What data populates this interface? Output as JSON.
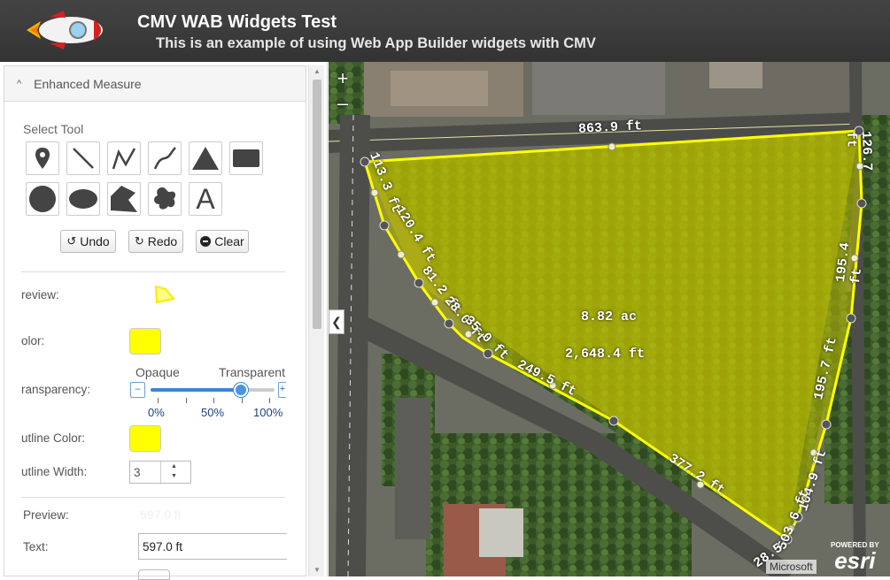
{
  "header": {
    "title": "CMV WAB Widgets Test",
    "subtitle": "This is an example of using Web App Builder widgets with CMV"
  },
  "panel": {
    "title": "Enhanced Measure",
    "select_tool": "Select Tool",
    "tools": [
      "point",
      "line",
      "polyline",
      "freehand-polyline",
      "triangle",
      "rectangle",
      "circle",
      "ellipse",
      "polygon",
      "freehand-polygon",
      "text"
    ],
    "text_tool_glyph": "A",
    "buttons": {
      "undo": "Undo",
      "redo": "Redo",
      "clear": "Clear"
    },
    "preview_label": "review:",
    "color_label": "olor:",
    "transparency_label": "ransparency:",
    "slider": {
      "left_label": "Opaque",
      "right_label": "Transparent",
      "ticks": [
        "0%",
        "50%",
        "100%"
      ],
      "value_percent": 73,
      "minus": "–",
      "plus": "+"
    },
    "outline_color_label": "utline Color:",
    "outline_width_label": "utline Width:",
    "outline_width_value": "3",
    "fill_color": "#ffff00",
    "text_section": {
      "preview_label": "Preview:",
      "preview_value": "597.0 ft",
      "text_label": "Text:",
      "text_value": "597.0 ft"
    }
  },
  "map": {
    "zoom_in": "+",
    "zoom_out": "–",
    "collapse": "❮",
    "labels": {
      "top": "863.9 ft",
      "area": "8.82 ac",
      "perimeter": "2,648.4 ft",
      "mid": "249.5 ft",
      "bottom_edge": "377.2 ft",
      "right1": "126.7 ft",
      "right2": "195.4 ft",
      "right3": "195.7 ft",
      "right4": "104.9 ft",
      "right5": "503.6 ft",
      "bottom": "28.5",
      "left1": "113.3 ft",
      "left2": "120.4 ft",
      "left3": "81.2 ft",
      "left4": "28.0 ft",
      "left5": "35.0 ft"
    },
    "attribution": "Microsoft",
    "esri_powered": "POWERED BY",
    "esri_name": "esri"
  }
}
